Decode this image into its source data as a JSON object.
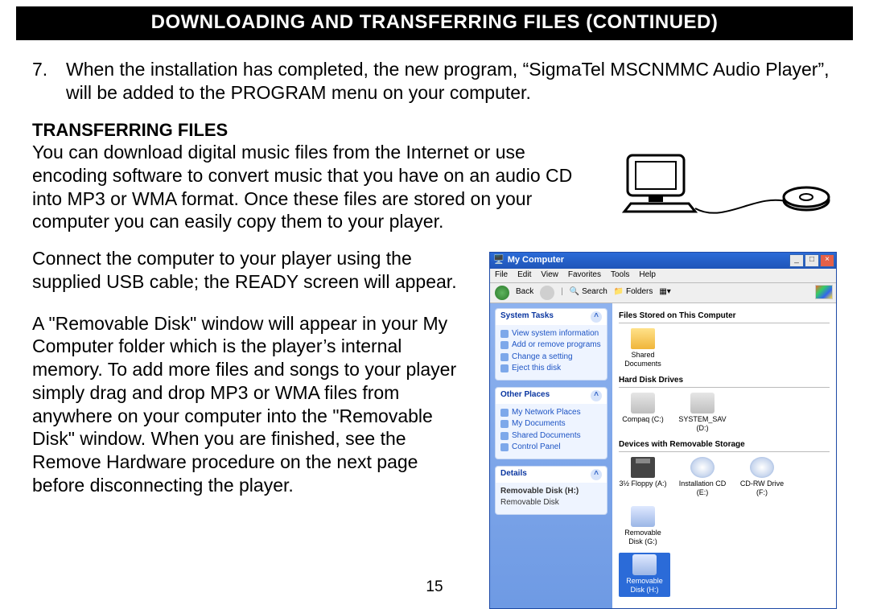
{
  "title": "DOWNLOADING AND TRANSFERRING FILES (CONTINUED)",
  "step7_num": "7.",
  "step7_text": "When the installation has completed, the new program, “SigmaTel MSCNMMC Audio Player”, will be added to the PROGRAM menu on your computer.",
  "subhead": "TRANSFERRING FILES",
  "para1": "You can download digital music files from the Internet or use encoding software to convert music that you have on an audio CD into MP3 or WMA format. Once these files are stored on your computer you can easily copy them to your player.",
  "para2": "Connect the computer to your player using the supplied USB cable; the READY screen will appear.",
  "para3": "A \"Removable Disk\" window will appear in your My Computer folder which is the player’s internal memory. To add more files and songs to your player simply drag and drop MP3 or WMA files from anywhere on your computer into the \"Removable Disk\" window. When you are finished, see the Remove Hardware procedure on the next page before disconnecting the player.",
  "pagenum": "15",
  "mycomputer": {
    "title": "My Computer",
    "menu": [
      "File",
      "Edit",
      "View",
      "Favorites",
      "Tools",
      "Help"
    ],
    "toolbar": {
      "back": "Back",
      "search": "Search",
      "folders": "Folders"
    },
    "side": {
      "system_tasks": {
        "title": "System Tasks",
        "items": [
          "View system information",
          "Add or remove programs",
          "Change a setting",
          "Eject this disk"
        ]
      },
      "other_places": {
        "title": "Other Places",
        "items": [
          "My Network Places",
          "My Documents",
          "Shared Documents",
          "Control Panel"
        ]
      },
      "details": {
        "title": "Details",
        "items": [
          "Removable Disk (H:)",
          "Removable Disk"
        ]
      }
    },
    "content": {
      "group1": {
        "title": "Files Stored on This Computer",
        "items": [
          {
            "label": "Shared Documents"
          }
        ]
      },
      "group2": {
        "title": "Hard Disk Drives",
        "items": [
          {
            "label": "Compaq (C:)"
          },
          {
            "label": "SYSTEM_SAV (D:)"
          }
        ]
      },
      "group3": {
        "title": "Devices with Removable Storage",
        "items": [
          {
            "label": "3½ Floppy (A:)"
          },
          {
            "label": "Installation CD (E:)"
          },
          {
            "label": "CD-RW Drive (F:)"
          },
          {
            "label": "Removable Disk (G:)"
          },
          {
            "label": "Removable Disk (H:)",
            "selected": true
          }
        ]
      }
    }
  }
}
